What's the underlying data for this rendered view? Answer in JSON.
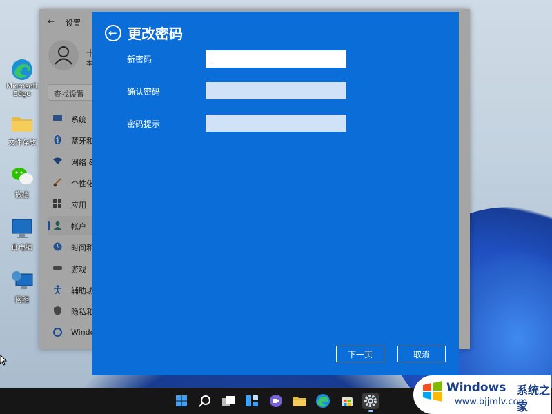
{
  "desktop_icons": [
    {
      "label": "Microsoft Edge",
      "icon": "edge-icon"
    },
    {
      "label": "文件存放",
      "icon": "folder-icon"
    },
    {
      "label": "微信",
      "icon": "wechat-icon"
    },
    {
      "label": "此电脑",
      "icon": "computer-icon"
    },
    {
      "label": "网络",
      "icon": "network-icon"
    }
  ],
  "settings": {
    "title": "设置",
    "user_name": "十",
    "user_sub": "本",
    "search_placeholder": "查找设置",
    "nav_items": [
      {
        "label": "系统",
        "icon": "system-icon"
      },
      {
        "label": "蓝牙和",
        "icon": "bluetooth-icon"
      },
      {
        "label": "网络 &",
        "icon": "wifi-icon"
      },
      {
        "label": "个性化",
        "icon": "brush-icon"
      },
      {
        "label": "应用",
        "icon": "apps-icon"
      },
      {
        "label": "帐户",
        "icon": "account-icon",
        "active": true
      },
      {
        "label": "时间和",
        "icon": "clock-icon"
      },
      {
        "label": "游戏",
        "icon": "gamepad-icon"
      },
      {
        "label": "辅助功",
        "icon": "accessibility-icon"
      },
      {
        "label": "隐私和",
        "icon": "shield-icon"
      },
      {
        "label": "Windo",
        "icon": "windows-update-icon"
      }
    ]
  },
  "dialog": {
    "title": "更改密码",
    "fields": [
      {
        "label": "新密码",
        "value": ""
      },
      {
        "label": "确认密码",
        "value": ""
      },
      {
        "label": "密码提示",
        "value": ""
      }
    ],
    "next_label": "下一页",
    "cancel_label": "取消"
  },
  "taskbar": {
    "icons": [
      "start-icon",
      "search-icon",
      "task-view-icon",
      "widgets-icon",
      "teams-chat-icon",
      "file-explorer-icon",
      "edge-icon",
      "store-icon",
      "settings-icon"
    ],
    "active": "settings-icon"
  },
  "watermark": {
    "brand": "Windows",
    "cn": "系统之家",
    "url": "www.bjjmlv.com"
  },
  "colors": {
    "dialog_bg": "#0a6dd8",
    "taskbar_bg": "#161616",
    "accent": "#2f6fd0"
  }
}
